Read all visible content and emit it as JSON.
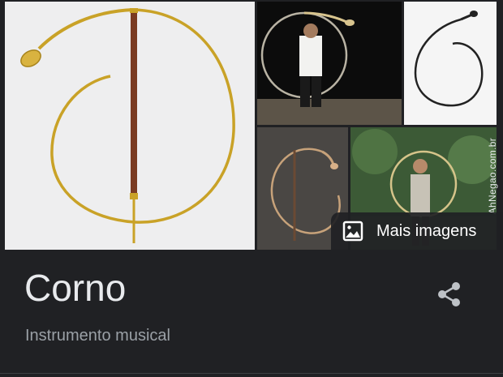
{
  "panel": {
    "title": "Corno",
    "subtitle": "Instrumento musical"
  },
  "gallery": {
    "more_images_label": "Mais imagens",
    "watermark": "AhNegao.com.br",
    "more_images_icon": "image-icon"
  },
  "actions": {
    "share_icon": "share-icon"
  },
  "colors": {
    "background": "#202124",
    "title": "#e8eaed",
    "subtitle": "#9aa0a6",
    "brass": "#c9a227"
  }
}
